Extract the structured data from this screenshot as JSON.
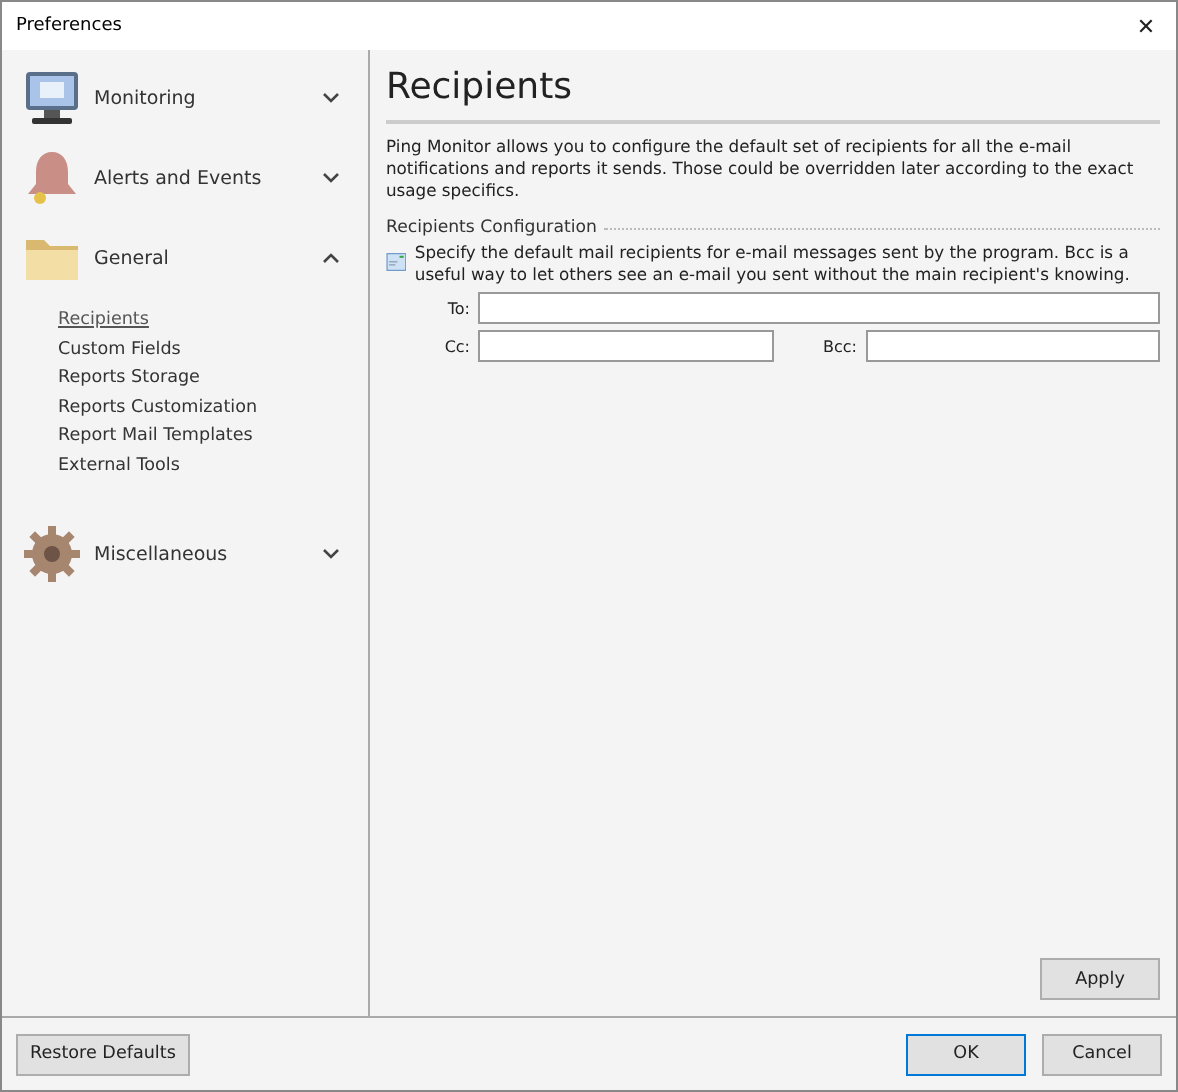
{
  "window": {
    "title": "Preferences",
    "close": "✕"
  },
  "sidebar": {
    "groups": [
      {
        "label": "Monitoring",
        "expanded": false
      },
      {
        "label": "Alerts and Events",
        "expanded": false
      },
      {
        "label": "General",
        "expanded": true,
        "items": [
          {
            "label": "Recipients",
            "selected": true
          },
          {
            "label": "Custom Fields",
            "selected": false
          },
          {
            "label": "Reports Storage",
            "selected": false
          },
          {
            "label": "Reports Customization",
            "selected": false
          },
          {
            "label": "Report Mail Templates",
            "selected": false
          },
          {
            "label": "External Tools",
            "selected": false
          }
        ]
      },
      {
        "label": "Miscellaneous",
        "expanded": false
      }
    ]
  },
  "content": {
    "title": "Recipients",
    "description": "Ping Monitor allows you to configure the default set of recipients for all the e-mail notifications and reports it sends. Those could be overridden later according to the exact usage specifics.",
    "section": {
      "title": "Recipients Configuration",
      "hint": "Specify the default mail recipients for e-mail messages sent by the program. Bcc is a useful way to let others see an e-mail you sent without the main recipient's knowing."
    },
    "fields": {
      "to": {
        "label": "To:"
      },
      "cc": {
        "label": "Cc:"
      },
      "bcc": {
        "label": "Bcc:"
      }
    },
    "apply": "Apply"
  },
  "footer": {
    "restore": "Restore Defaults",
    "ok": "OK",
    "cancel": "Cancel"
  }
}
